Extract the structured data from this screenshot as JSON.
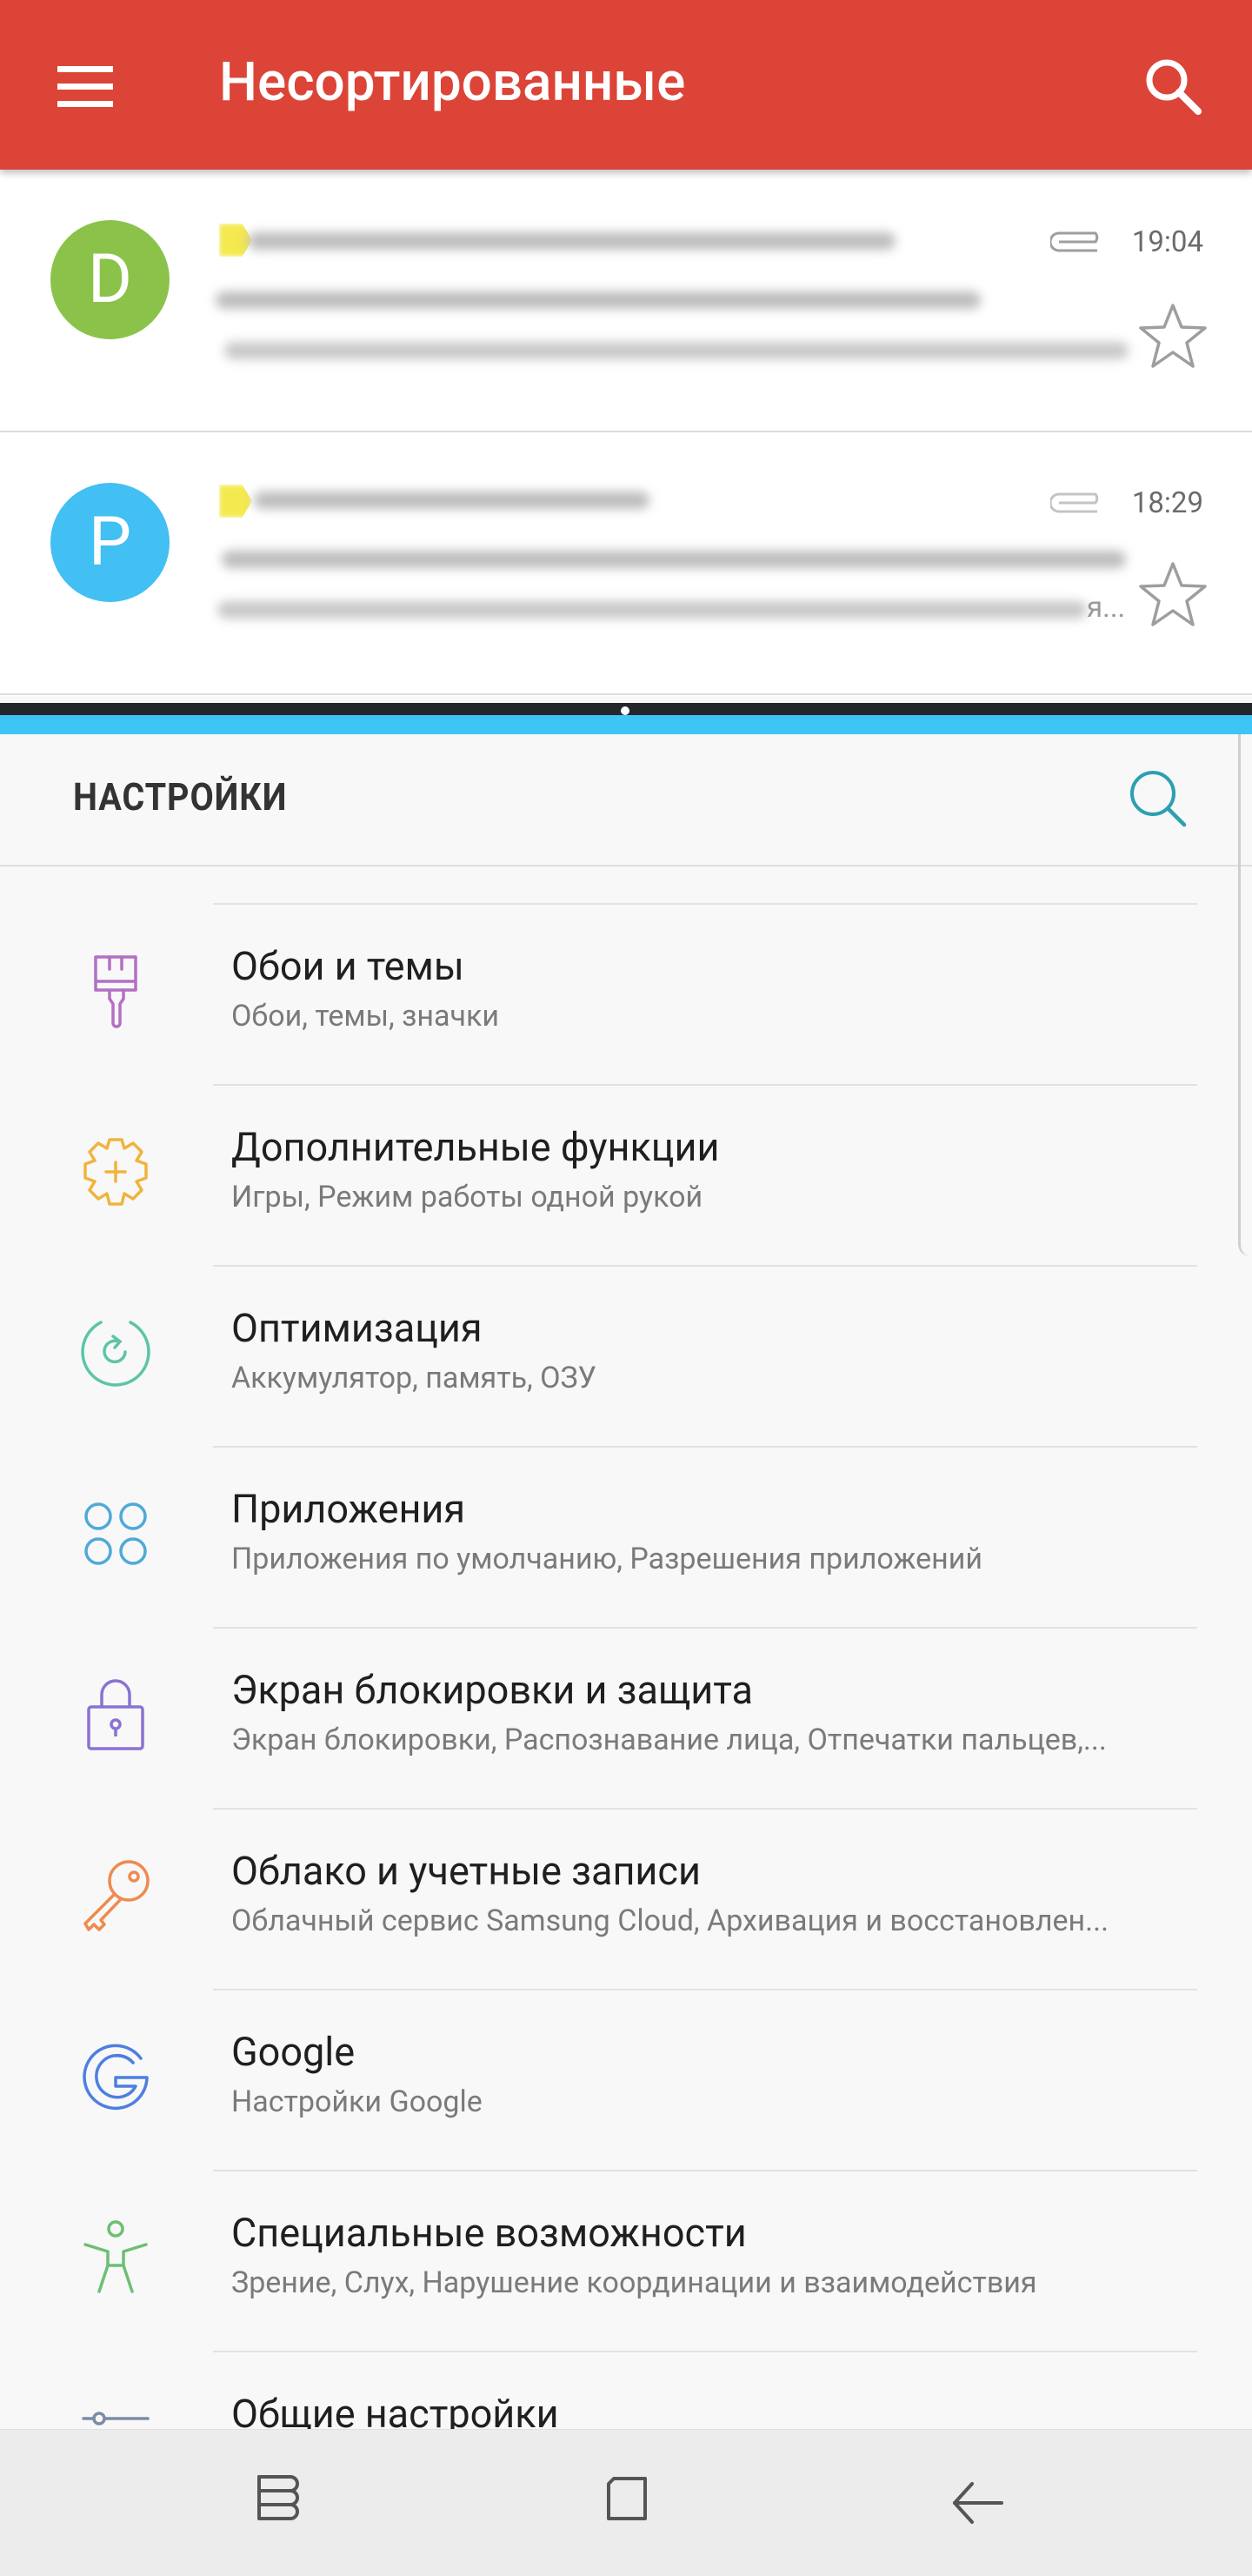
{
  "gmail": {
    "title": "Несортированные",
    "menu_icon": "hamburger-menu-icon",
    "search_icon": "search-icon",
    "accent": "#db4437",
    "messages": [
      {
        "avatar_letter": "D",
        "avatar_color": "#8bc34a",
        "time": "19:04"
      },
      {
        "avatar_letter": "P",
        "avatar_color": "#42bff3",
        "time": "18:29",
        "snippet_end": "я..."
      }
    ]
  },
  "settings": {
    "title": "НАСТРОЙКИ",
    "search_icon": "search-icon",
    "items": [
      {
        "label": "Обои и темы",
        "sub": "Обои, темы, значки",
        "icon": "brush-icon"
      },
      {
        "label": "Дополнительные функции",
        "sub": "Игры, Режим работы одной рукой",
        "icon": "gear-plus-icon"
      },
      {
        "label": "Оптимизация",
        "sub": "Аккумулятор, память, ОЗУ",
        "icon": "refresh-circle-icon"
      },
      {
        "label": "Приложения",
        "sub": "Приложения по умолчанию, Разрешения приложений",
        "icon": "apps-icon"
      },
      {
        "label": "Экран блокировки и защита",
        "sub": "Экран блокировки, Распознавание лица, Отпечатки пальцев,...",
        "icon": "lock-icon"
      },
      {
        "label": "Облако и учетные записи",
        "sub": "Облачный сервис Samsung Cloud, Архивация и восстановлен...",
        "icon": "key-icon"
      },
      {
        "label": "Google",
        "sub": "Настройки Google",
        "icon": "google-icon"
      },
      {
        "label": "Специальные возможности",
        "sub": "Зрение, Слух, Нарушение координации и взаимодействия",
        "icon": "accessibility-icon"
      },
      {
        "label": "Общие настройки",
        "sub": "",
        "icon": "sliders-icon"
      }
    ]
  },
  "navbar": {
    "recents_icon": "recents-icon",
    "home_icon": "home-icon",
    "back_icon": "back-arrow-icon"
  }
}
